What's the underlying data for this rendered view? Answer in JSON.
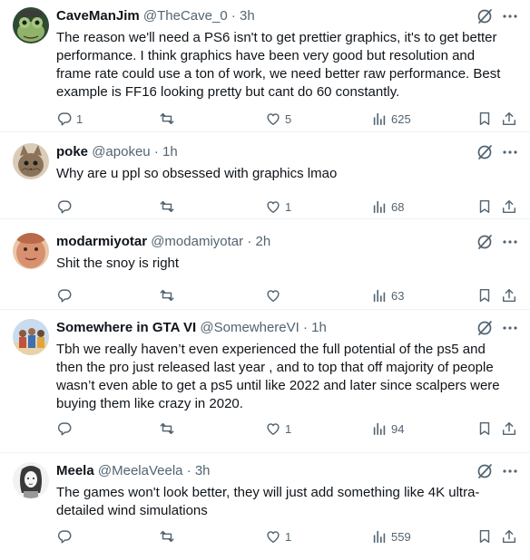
{
  "posts": [
    {
      "name": "CaveManJim",
      "handle": "@TheCave_0",
      "dot": "·",
      "time": "3h",
      "text": "The reason we'll need a PS6 isn't to get prettier graphics, it's to get better performance. I think graphics have been very good but resolution and frame rate could use a ton of work, we need better raw performance. Best example is FF16 looking pretty but cant do 60 constantly.",
      "replies": "1",
      "reposts": "",
      "likes": "5",
      "views": "625",
      "avatar_icon": "frog-avatar"
    },
    {
      "name": "poke",
      "handle": "@apokeu",
      "dot": "·",
      "time": "1h",
      "text": "Why are u ppl so obsessed with graphics lmao",
      "replies": "",
      "reposts": "",
      "likes": "1",
      "views": "68",
      "avatar_icon": "cat-avatar"
    },
    {
      "name": "modarmiyotar",
      "handle": "@modamiyotar",
      "dot": "·",
      "time": "2h",
      "text": "Shit the snoy is right",
      "replies": "",
      "reposts": "",
      "likes": "",
      "views": "63",
      "avatar_icon": "face-avatar"
    },
    {
      "name": "Somewhere in GTA VI",
      "handle": "@SomewhereVI",
      "dot": "·",
      "time": "1h",
      "text": "Tbh we really haven’t even experienced the full potential of the ps5 and then the pro just released last year , and to top that off majority of people wasn’t even able to get a ps5 until like 2022 and later since scalpers were buying them like crazy in 2020.",
      "replies": "",
      "reposts": "",
      "likes": "1",
      "views": "94",
      "avatar_icon": "group-avatar"
    },
    {
      "name": "Meela",
      "handle": "@MeelaVeela",
      "dot": "·",
      "time": "3h",
      "text": "The games won't look better, they will just add something like 4K ultra-detailed wind simulations",
      "replies": "",
      "reposts": "",
      "likes": "1",
      "views": "559",
      "avatar_icon": "sketch-avatar"
    }
  ],
  "colors": {
    "text": "#0f1419",
    "secondary": "#536471",
    "divider": "#eff3f4"
  }
}
